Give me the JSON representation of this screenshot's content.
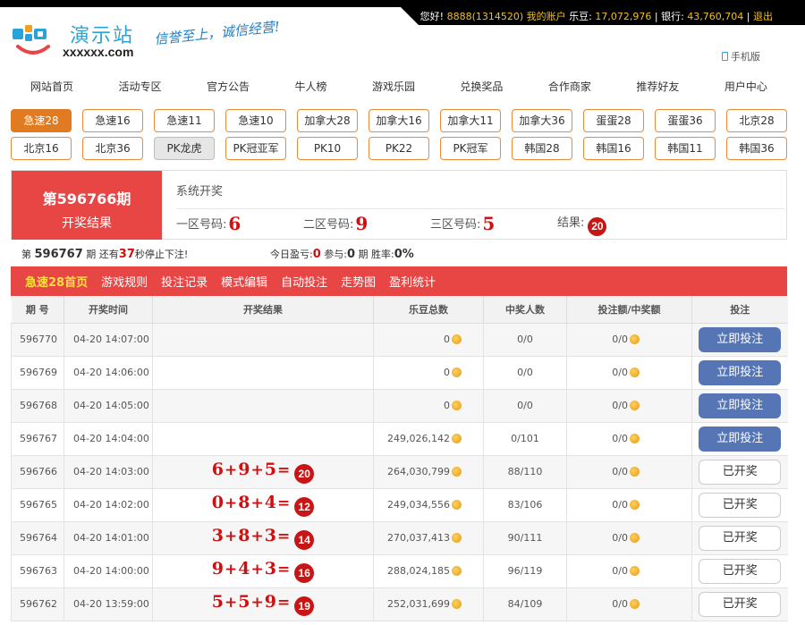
{
  "userbar": {
    "greeting": "您好!",
    "user": "8888(1314520)",
    "account": "我的账户",
    "ledou_label": "乐豆:",
    "ledou": "17,072,976",
    "bank_label": "银行:",
    "bank": "43,760,704",
    "logout": "退出"
  },
  "logo": {
    "title": "演示站",
    "domain": "xxxxxx.com",
    "slogan": "信誉至上，诚信经营!"
  },
  "mobile_label": "手机版",
  "mainnav": [
    "网站首页",
    "活动专区",
    "官方公告",
    "牛人榜",
    "游戏乐园",
    "兑换奖品",
    "合作商家",
    "推荐好友",
    "用户中心"
  ],
  "games_row1": [
    "急速28",
    "急速16",
    "急速11",
    "急速10",
    "加拿大28",
    "加拿大16",
    "加拿大11",
    "加拿大36",
    "蛋蛋28",
    "蛋蛋36",
    "北京28"
  ],
  "games_row2": [
    "北京16",
    "北京36",
    "PK龙虎",
    "PK冠亚军",
    "PK10",
    "PK22",
    "PK冠军",
    "韩国28",
    "韩国16",
    "韩国11",
    "韩国36"
  ],
  "period": {
    "title": "第596766期",
    "subtitle": "开奖结果",
    "system": "系统开奖",
    "zone1_label": "一区号码:",
    "zone1": "6",
    "zone2_label": "二区号码:",
    "zone2": "9",
    "zone3_label": "三区号码:",
    "zone3": "5",
    "result_label": "结果:",
    "result": "20"
  },
  "info": {
    "prefix": "第",
    "period": "596767",
    "mid": "期 还有",
    "seconds": "37",
    "suffix": "秒停止下注!",
    "today": "今日盈亏:",
    "profit": "0",
    "join": "参与:",
    "count": "0",
    "unit": "期 胜率:",
    "rate": "0%"
  },
  "subnav": [
    "急速28首页",
    "游戏规则",
    "投注记录",
    "模式编辑",
    "自动投注",
    "走势图",
    "盈利统计"
  ],
  "table": {
    "headers": [
      "期 号",
      "开奖时间",
      "开奖结果",
      "乐豆总数",
      "中奖人数",
      "投注额/中奖额",
      "投注"
    ],
    "rows": [
      {
        "period": "596770",
        "time": "04-20 14:07:00",
        "total": "0",
        "winners": "0/0",
        "ratio": "0/0",
        "action": "立即投注"
      },
      {
        "period": "596769",
        "time": "04-20 14:06:00",
        "total": "0",
        "winners": "0/0",
        "ratio": "0/0",
        "action": "立即投注"
      },
      {
        "period": "596768",
        "time": "04-20 14:05:00",
        "total": "0",
        "winners": "0/0",
        "ratio": "0/0",
        "action": "立即投注"
      },
      {
        "period": "596767",
        "time": "04-20 14:04:00",
        "total": "249,026,142",
        "winners": "0/101",
        "ratio": "0/0",
        "action": "立即投注"
      },
      {
        "period": "596766",
        "time": "04-20 14:03:00",
        "a": "6",
        "b": "9",
        "c": "5",
        "r": "20",
        "total": "264,030,799",
        "winners": "88/110",
        "ratio": "0/0",
        "action": "已开奖"
      },
      {
        "period": "596765",
        "time": "04-20 14:02:00",
        "a": "0",
        "b": "8",
        "c": "4",
        "r": "12",
        "total": "249,034,556",
        "winners": "83/106",
        "ratio": "0/0",
        "action": "已开奖"
      },
      {
        "period": "596764",
        "time": "04-20 14:01:00",
        "a": "3",
        "b": "8",
        "c": "3",
        "r": "14",
        "total": "270,037,413",
        "winners": "90/111",
        "ratio": "0/0",
        "action": "已开奖"
      },
      {
        "period": "596763",
        "time": "04-20 14:00:00",
        "a": "9",
        "b": "4",
        "c": "3",
        "r": "16",
        "total": "288,024,185",
        "winners": "96/119",
        "ratio": "0/0",
        "action": "已开奖"
      },
      {
        "period": "596762",
        "time": "04-20 13:59:00",
        "a": "5",
        "b": "5",
        "c": "9",
        "r": "19",
        "total": "252,031,699",
        "winners": "84/109",
        "ratio": "0/0",
        "action": "已开奖"
      }
    ]
  },
  "colors": {
    "accent_red": "#e84545",
    "orange": "#e07b22",
    "bet_blue": "#5575b5",
    "ball_red": "#c81616"
  },
  "icons": {
    "coin": "coin-icon",
    "phone": "phone-icon",
    "logo": "logo-mark-icon"
  }
}
